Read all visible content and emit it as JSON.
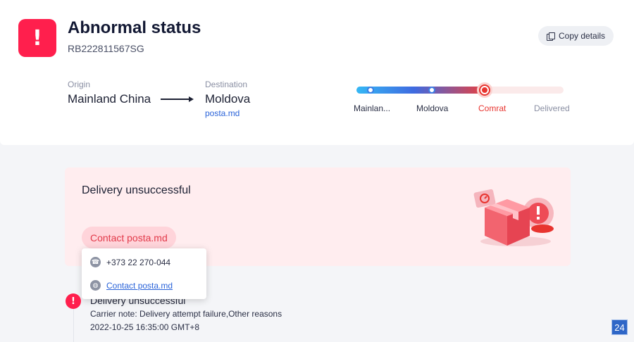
{
  "header": {
    "status_title": "Abnormal status",
    "tracking_number": "RB222811567SG",
    "copy_label": "Copy details"
  },
  "route": {
    "origin_label": "Origin",
    "origin_value": "Mainland China",
    "destination_label": "Destination",
    "destination_value": "Moldova",
    "destination_link": "posta.md"
  },
  "progress": {
    "stages": [
      "Mainlan...",
      "Moldova",
      "Comrat",
      "Delivered"
    ],
    "current_stage": "Comrat",
    "colors": {
      "start": "#35b8f5",
      "mid": "#3f6ae0",
      "current": "#e84040",
      "pending_label": "#8a8fa3"
    }
  },
  "alert": {
    "title": "Delivery unsuccessful",
    "contact_button": "Contact posta.md"
  },
  "contact_popup": {
    "phone": "+373 22 270-044",
    "link": "Contact posta.md"
  },
  "timeline": {
    "event_title": "Delivery unsuccessful",
    "note": "Carrier note: Delivery attempt failure,Other reasons",
    "time": "2022-10-25 16:35:00 GMT+8"
  },
  "badge": "24",
  "theme": {
    "accent_red": "#ff1f4d",
    "link_blue": "#2a63d9"
  }
}
